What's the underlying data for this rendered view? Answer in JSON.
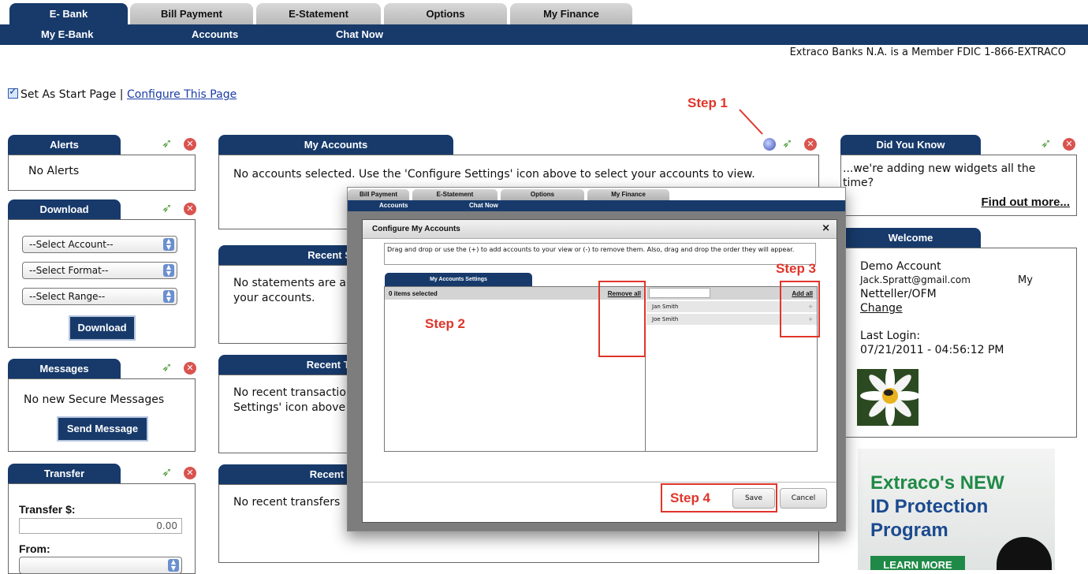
{
  "tabs": [
    "E- Bank",
    "Bill Payment",
    "E-Statement",
    "Options",
    "My Finance"
  ],
  "subnav": [
    "My E-Bank",
    "Accounts",
    "Chat Now"
  ],
  "fdic_text": "Extraco Banks N.A. is a Member FDIC 1-866-EXTRACO",
  "start_page": {
    "label": "Set As Start Page |",
    "configure_link": "Configure This Page"
  },
  "alerts": {
    "title": "Alerts",
    "text": "No Alerts"
  },
  "download": {
    "title": "Download",
    "selects": [
      "--Select Account--",
      "--Select Format--",
      "--Select Range--"
    ],
    "button": "Download"
  },
  "messages": {
    "title": "Messages",
    "text": "No new Secure Messages",
    "button": "Send Message"
  },
  "transfer": {
    "title": "Transfer",
    "amount_label": "Transfer $:",
    "amount_value": "0.00",
    "from_label": "From:"
  },
  "my_accounts": {
    "title": "My Accounts",
    "text": "No accounts selected. Use the 'Configure Settings' icon above to select your accounts to view."
  },
  "recent_statements": {
    "title": "Recent Stat",
    "text_line1": "No statements are a",
    "text_line2": "your accounts."
  },
  "recent_transactions": {
    "title": "Recent Tran",
    "text_line1": "No recent transactio",
    "text_line2": "Settings' icon above"
  },
  "recent_transfers": {
    "title": "Recent Tra",
    "text": "No recent transfers"
  },
  "did_you_know": {
    "title": "Did You Know",
    "text_line1": "...we're adding new widgets all the",
    "text_line2": "time?",
    "link": "Find out more..."
  },
  "welcome": {
    "title": "Welcome",
    "name": "Demo Account",
    "email": "Jack.Spratt@gmail.com",
    "tag1": "My",
    "tag2": "Netteller/OFM",
    "change_link": "Change",
    "last_login_label": "Last Login:",
    "last_login_value": "07/21/2011 - 04:56:12 PM"
  },
  "promo": {
    "line1": "Extraco's NEW",
    "line2": "ID Protection",
    "line3": "Program",
    "button": "LEARN MORE"
  },
  "modal": {
    "mini_tabs": [
      "Bill Payment",
      "E-Statement",
      "Options",
      "My Finance"
    ],
    "mini_nav": [
      "Accounts",
      "Chat Now"
    ],
    "title": "Configure My Accounts",
    "close": "×",
    "instructions": "Drag and drop or use the (+) to add accounts to your view or (-) to remove them. Also, drag and drop the order they will appear.",
    "settings_tab": "My Accounts Settings",
    "selected_count": "0 items selected",
    "remove_all": "Remove all",
    "add_all": "Add all",
    "accounts": [
      "Jan Smith",
      "Joe Smith"
    ],
    "save": "Save",
    "cancel": "Cancel"
  },
  "steps": [
    "Step 1",
    "Step 2",
    "Step 3",
    "Step 4"
  ],
  "colors": {
    "nav": "#173a6b",
    "step_red": "#e0352b",
    "promo_green": "#1f8a47",
    "promo_blue": "#1b4a8f"
  }
}
